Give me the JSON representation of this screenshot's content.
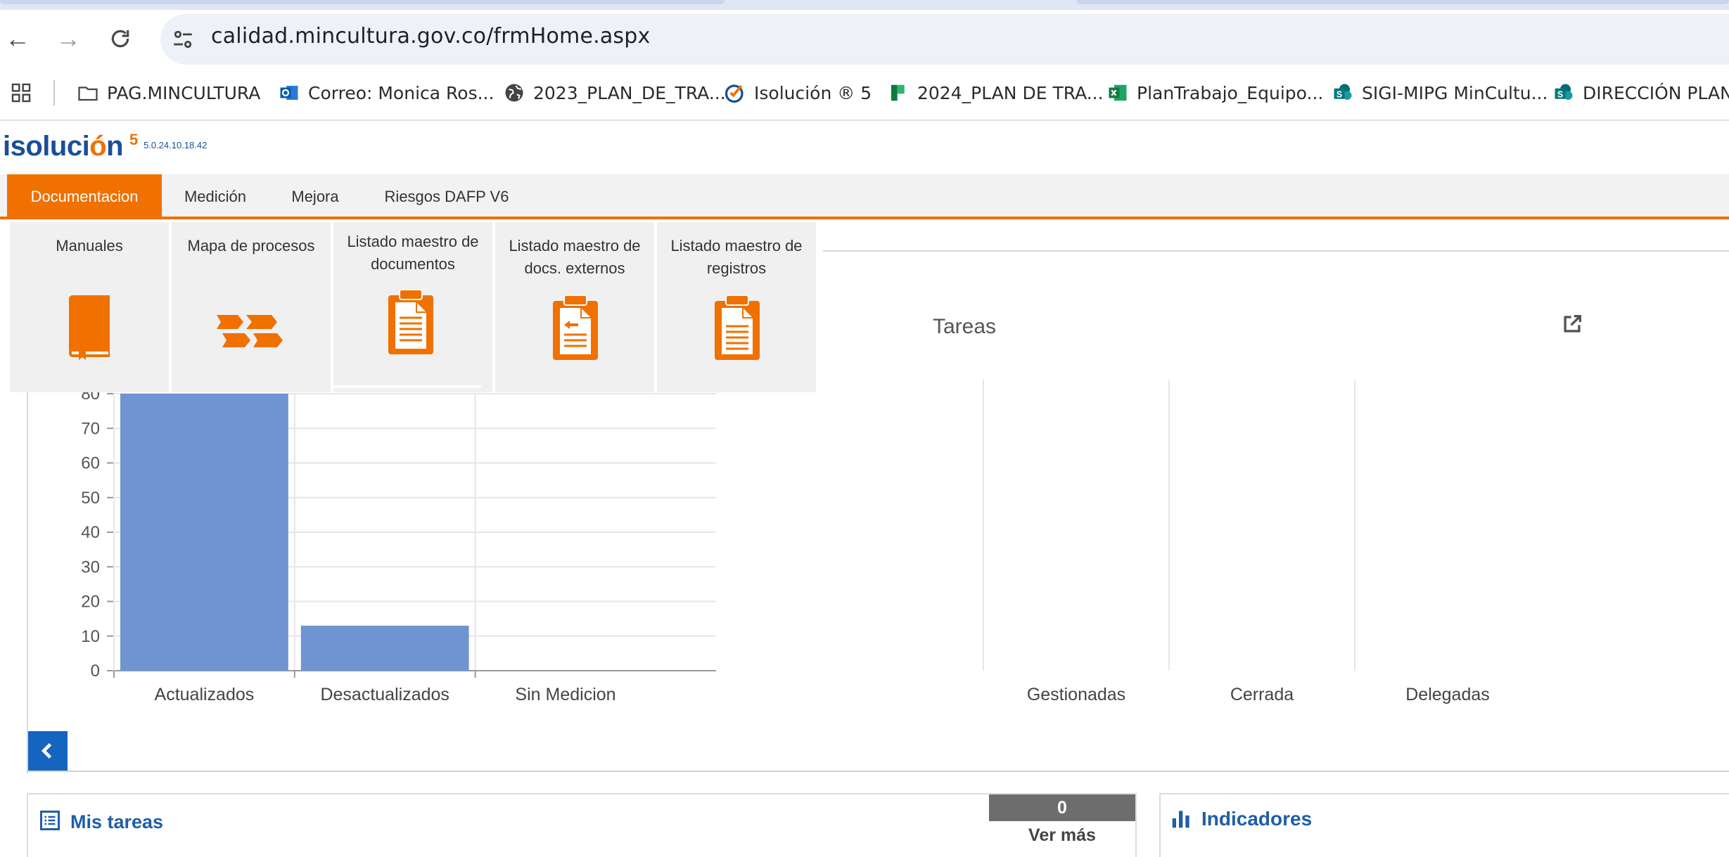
{
  "browser": {
    "url": "calidad.mincultura.gov.co/frmHome.aspx",
    "nav": {
      "back": "←",
      "forward": "→",
      "reload": "C"
    },
    "bookmarks": [
      {
        "label": "PAG.MINCULTURA",
        "icon": "folder-icon"
      },
      {
        "label": "Correo: Monica Ros...",
        "icon": "outlook-icon"
      },
      {
        "label": "2023_PLAN_DE_TRA...",
        "icon": "globe-icon"
      },
      {
        "label": "Isolución ® 5",
        "icon": "isolucion-icon"
      },
      {
        "label": "2024_PLAN DE TRA...",
        "icon": "planner-icon"
      },
      {
        "label": "PlanTrabajo_Equipo...",
        "icon": "excel-icon"
      },
      {
        "label": "SIGI-MIPG MinCultu...",
        "icon": "sharepoint-icon"
      },
      {
        "label": "DIRECCIÓN PLANE",
        "icon": "sharepoint-icon"
      }
    ]
  },
  "app": {
    "logo": {
      "text_a": "isoluci",
      "text_o": "ó",
      "text_b": "n",
      "sup": "5",
      "version": "5.0.24.10.18.42"
    },
    "menu": [
      {
        "label": "Documentacion",
        "active": true
      },
      {
        "label": "Medición",
        "active": false
      },
      {
        "label": "Mejora",
        "active": false
      },
      {
        "label": "Riesgos DAFP V6",
        "active": false
      }
    ],
    "dropdown": [
      {
        "label": "Manuales",
        "icon": "book-icon"
      },
      {
        "label": "Mapa de procesos",
        "icon": "process-map-icon"
      },
      {
        "label": "Listado maestro de documentos",
        "icon": "clipboard-document-icon"
      },
      {
        "label": "Listado maestro de docs. externos",
        "icon": "clipboard-external-icon"
      },
      {
        "label": "Listado maestro de registros",
        "icon": "clipboard-records-icon"
      }
    ]
  },
  "chart_data": [
    {
      "type": "bar",
      "categories": [
        "Actualizados",
        "Desactualizados",
        "Sin Medicion"
      ],
      "values": [
        80,
        13,
        0
      ],
      "ylim": [
        0,
        80
      ],
      "yticks": [
        0,
        10,
        20,
        30,
        40,
        50,
        60,
        70,
        80
      ],
      "grid": true,
      "colors": {
        "bar": "#7094d2"
      }
    },
    {
      "type": "bar",
      "title": "Tareas",
      "categories": [
        "Gestionadas",
        "Cerrada",
        "Delegadas"
      ],
      "values": [
        0,
        0,
        0
      ],
      "grid": true
    }
  ],
  "panels": {
    "mis_tareas": {
      "title": "Mis tareas",
      "count": "0",
      "more": "Ver más"
    },
    "indicadores": {
      "title": "Indicadores"
    }
  },
  "colors": {
    "accent": "#f07000",
    "brand_blue": "#1a4e9c",
    "button_blue": "#1565c0"
  }
}
